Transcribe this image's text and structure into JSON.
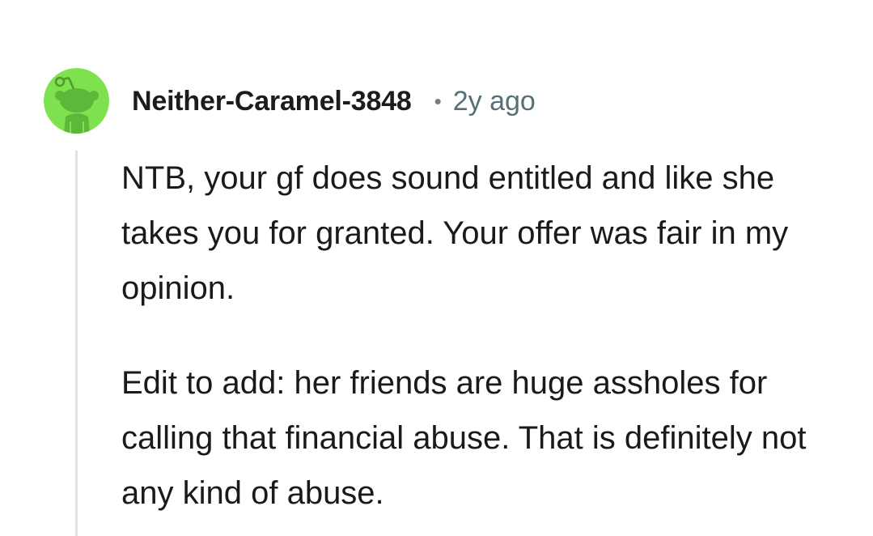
{
  "comment": {
    "author": "Neither-Caramel-3848",
    "separator": "•",
    "age": "2y ago",
    "avatar_icon": "snoo-avatar-icon",
    "avatar_color": "#7ee14e",
    "paragraphs": [
      "NTB, your gf does sound entitled and like she takes you for granted. Your offer was fair in my opinion.",
      "Edit to add: her friends are huge assholes for calling that financial abuse. That is definitely not any kind of abuse."
    ]
  }
}
